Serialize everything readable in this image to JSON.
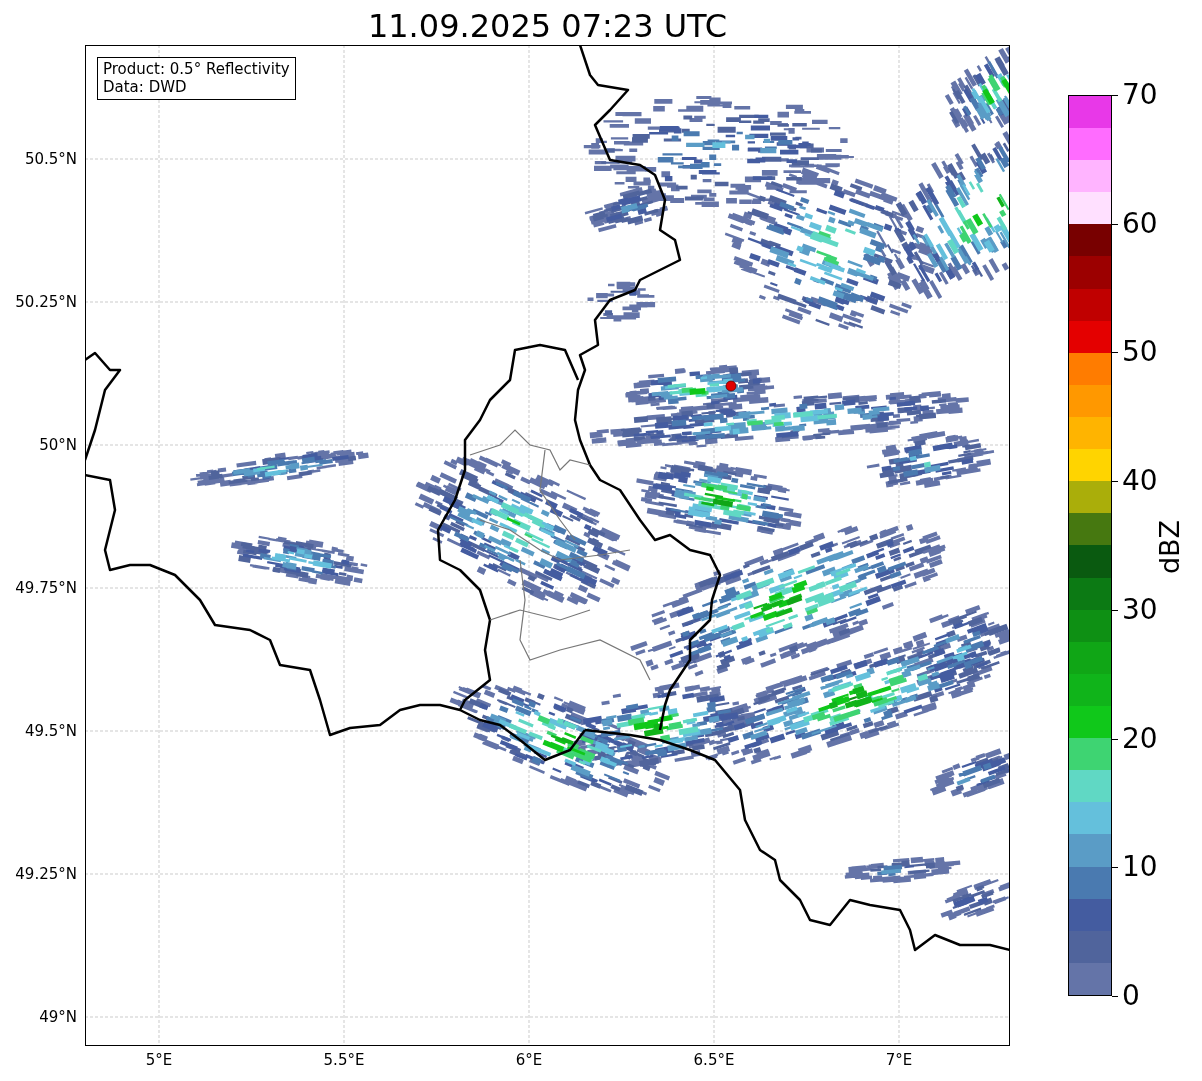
{
  "title": "11.09.2025 07:23 UTC",
  "map": {
    "info_box": {
      "lines": [
        "Product: 0.5° Reflectivity",
        "Data: DWD"
      ]
    },
    "longitude_labels": [
      "5°E",
      "5.5°E",
      "6°E",
      "6.5°E",
      "7°E"
    ],
    "latitude_labels": [
      "50.5°N",
      "50.25°N",
      "50°N",
      "49.75°N",
      "49.5°N",
      "49.25°N",
      "49°N"
    ]
  },
  "colorbar": {
    "label": "dBZ",
    "ticks": [
      "70",
      "60",
      "50",
      "40",
      "30",
      "20",
      "10",
      "0"
    ],
    "bands": [
      {
        "color": "#6474a8"
      },
      {
        "color": "#50649c"
      },
      {
        "color": "#445ca0"
      },
      {
        "color": "#4a7ab0"
      },
      {
        "color": "#5a9cc6"
      },
      {
        "color": "#64c0dc"
      },
      {
        "color": "#60d8c4"
      },
      {
        "color": "#3ed472"
      },
      {
        "color": "#10c81a"
      },
      {
        "color": "#10b41a"
      },
      {
        "color": "#10a616"
      },
      {
        "color": "#0e9014"
      },
      {
        "color": "#0c7a14"
      },
      {
        "color": "#0a5a10"
      },
      {
        "color": "#467810"
      },
      {
        "color": "#aaae0a"
      },
      {
        "color": "#ffd400"
      },
      {
        "color": "#ffb400"
      },
      {
        "color": "#ff9800"
      },
      {
        "color": "#ff7c00"
      },
      {
        "color": "#e40000"
      },
      {
        "color": "#c00000"
      },
      {
        "color": "#9c0000"
      },
      {
        "color": "#780000"
      },
      {
        "color": "#ffe0ff"
      },
      {
        "color": "#ffb4ff"
      },
      {
        "color": "#ff6cff"
      },
      {
        "color": "#e838e8"
      }
    ]
  }
}
